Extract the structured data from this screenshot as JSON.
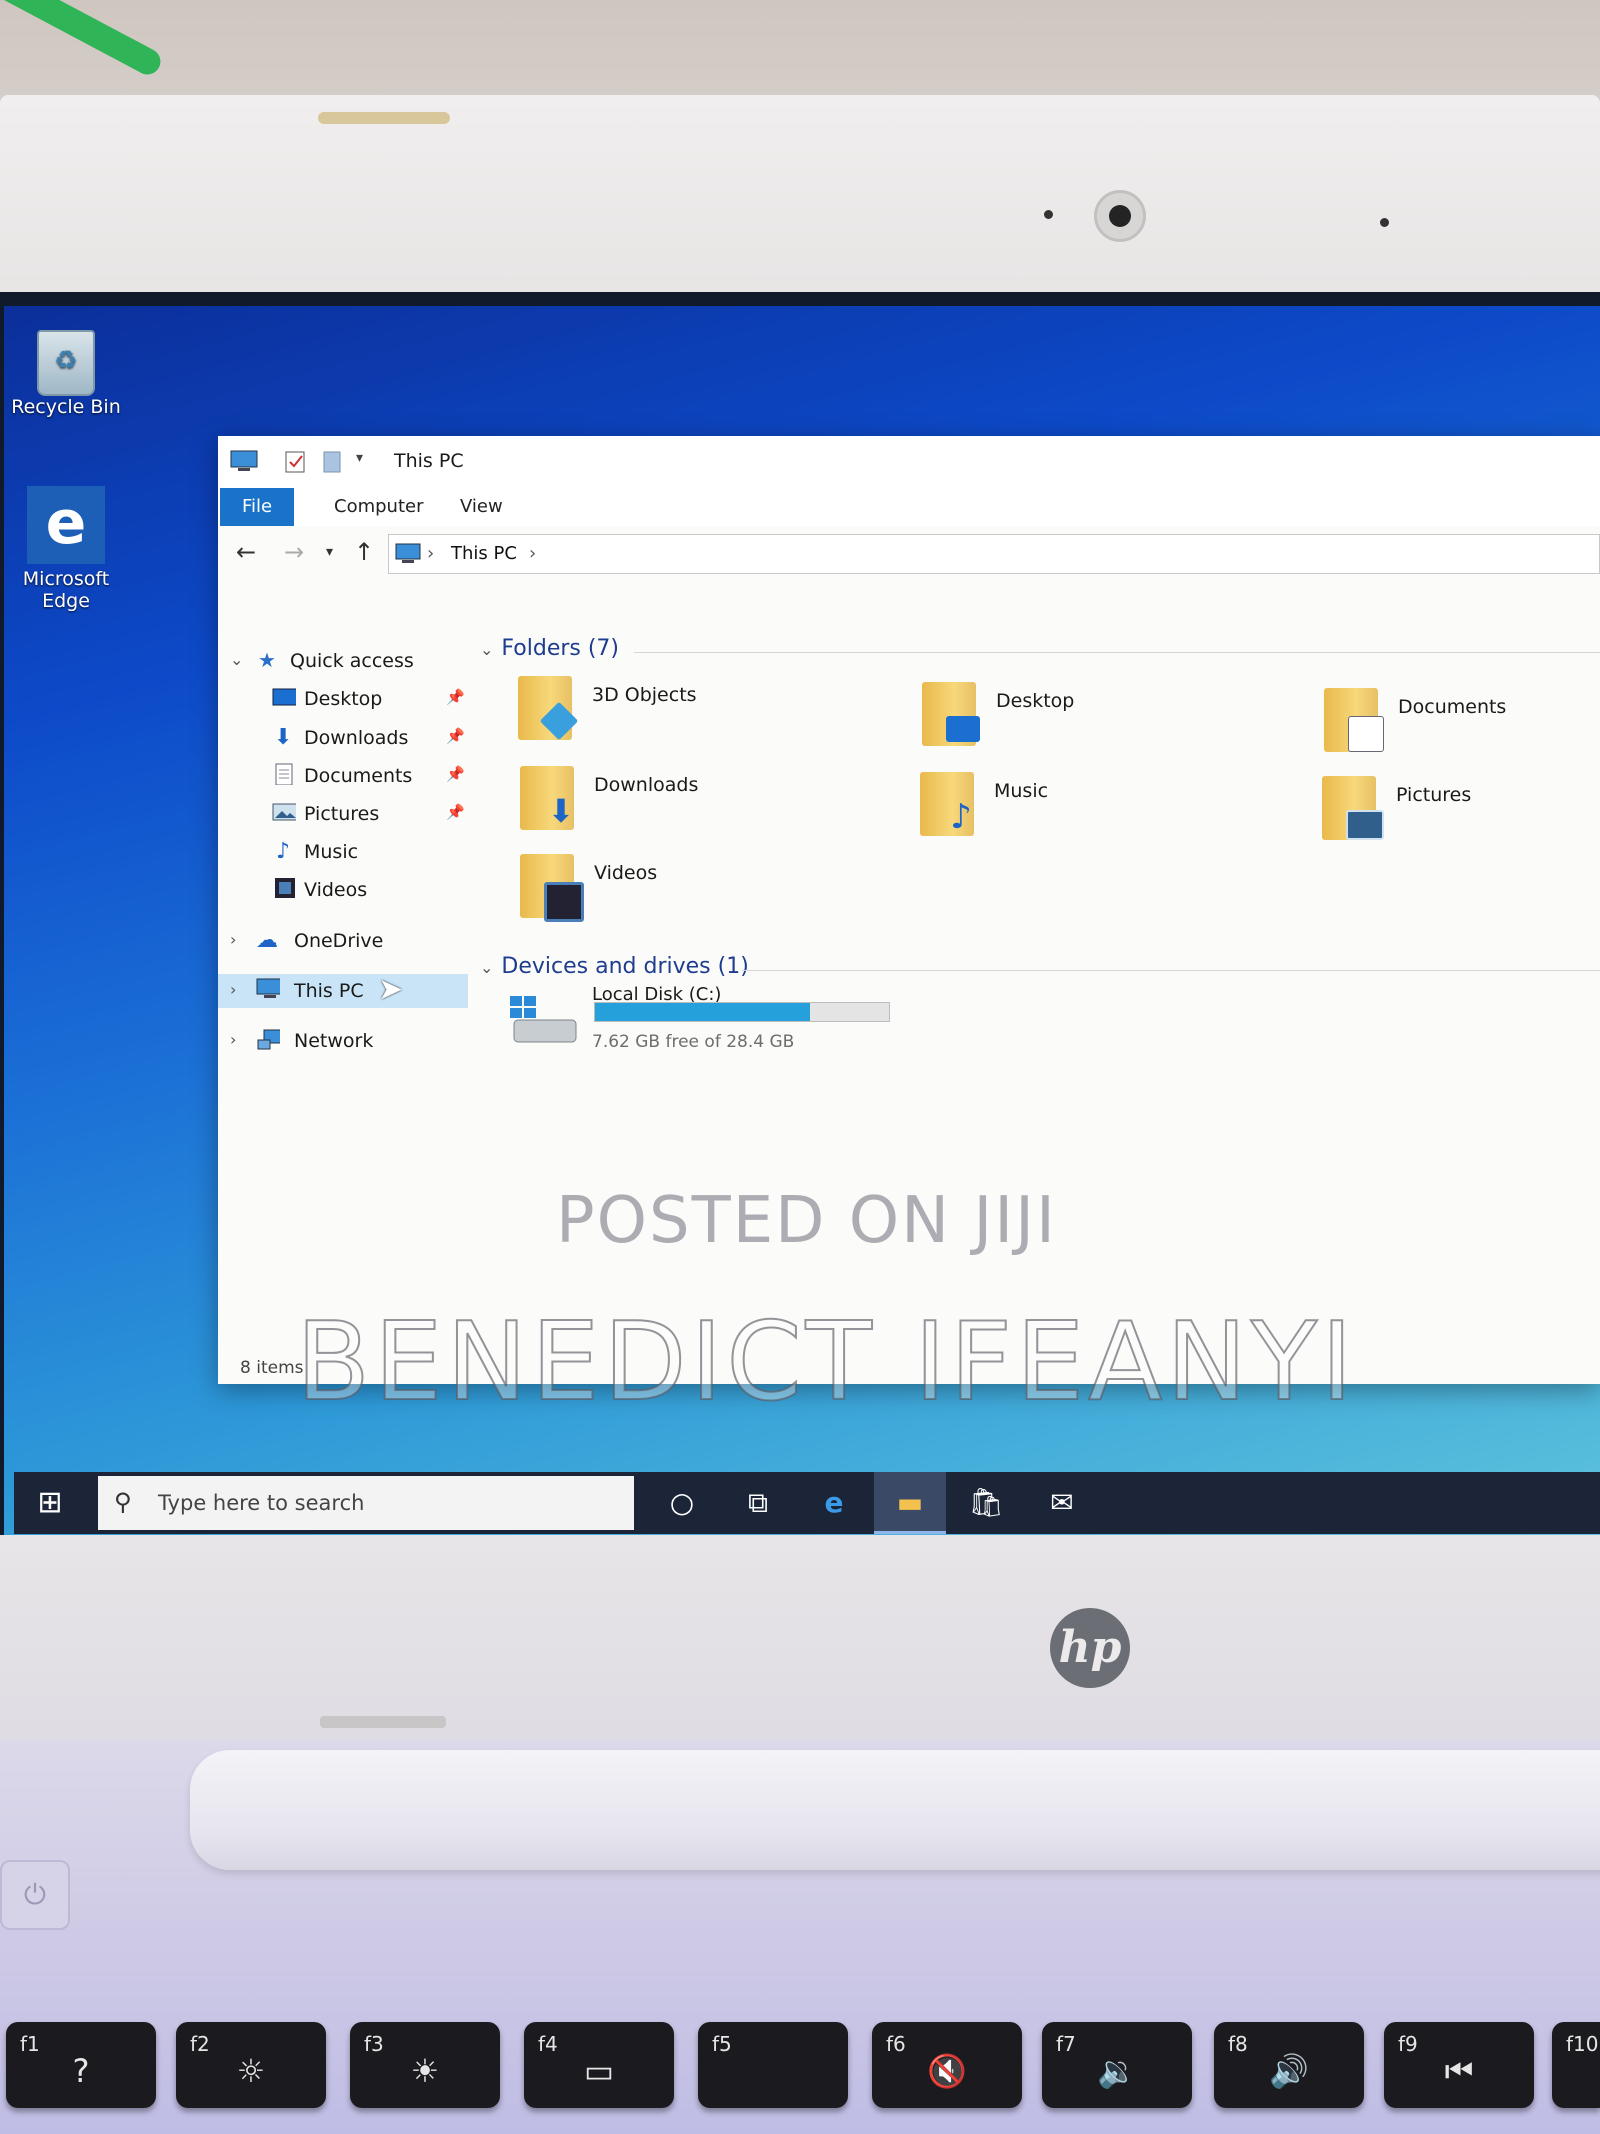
{
  "desktop": {
    "icons": [
      {
        "label": "Recycle Bin"
      },
      {
        "label": "Microsoft Edge"
      }
    ]
  },
  "window": {
    "title": "This PC",
    "ribbon_tabs": [
      "File",
      "Computer",
      "View"
    ],
    "address": {
      "crumb": "This PC"
    },
    "sidebar": {
      "quick_access": "Quick access",
      "qa_items": [
        "Desktop",
        "Downloads",
        "Documents",
        "Pictures",
        "Music",
        "Videos"
      ],
      "onedrive": "OneDrive",
      "this_pc": "This PC",
      "network": "Network"
    },
    "folders_heading": "Folders (7)",
    "folders": [
      "3D Objects",
      "Desktop",
      "Documents",
      "Downloads",
      "Music",
      "Pictures",
      "Videos"
    ],
    "devices_heading": "Devices and drives (1)",
    "drive": {
      "name": "Local Disk (C:)",
      "free_text": "7.62 GB free of 28.4 GB",
      "used_fraction": 0.732
    },
    "status": "8 items"
  },
  "taskbar": {
    "search_placeholder": "Type here to search"
  },
  "watermark": {
    "line1": "POSTED ON JIJI",
    "line2": "BENEDICT IFEANYI"
  },
  "laptop": {
    "brand": "hp",
    "fkeys": [
      {
        "fn": "f1",
        "glyph": "?"
      },
      {
        "fn": "f2",
        "glyph": "☼"
      },
      {
        "fn": "f3",
        "glyph": "☀"
      },
      {
        "fn": "f4",
        "glyph": "▭"
      },
      {
        "fn": "f5",
        "glyph": ""
      },
      {
        "fn": "f6",
        "glyph": "🔇"
      },
      {
        "fn": "f7",
        "glyph": "🔉"
      },
      {
        "fn": "f8",
        "glyph": "🔊"
      },
      {
        "fn": "f9",
        "glyph": "⏮"
      },
      {
        "fn": "f10",
        "glyph": ""
      }
    ]
  },
  "colors": {
    "accent": "#1a73c9",
    "drive_fill": "#26a0da",
    "taskbar": "#1b2537"
  }
}
